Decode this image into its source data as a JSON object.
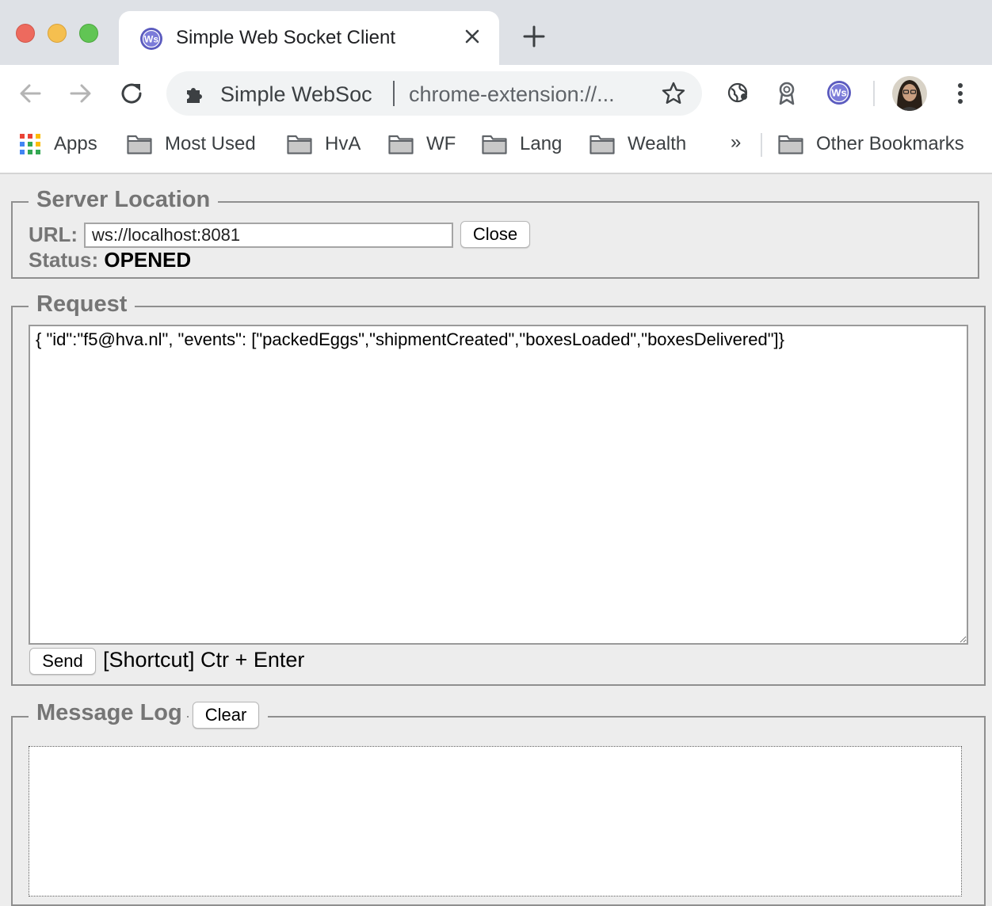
{
  "window": {
    "tab_title": "Simple Web Socket Client",
    "new_tab_symbol": "+",
    "close_symbol": "✕"
  },
  "toolbar": {
    "omnibox_site_name": "Simple WebSoc",
    "omnibox_url": "chrome-extension://..."
  },
  "bookmarks": {
    "items": [
      {
        "label": "Apps",
        "icon": "apps-grid-icon"
      },
      {
        "label": "Most Used",
        "icon": "folder-icon"
      },
      {
        "label": "HvA",
        "icon": "folder-icon"
      },
      {
        "label": "WF",
        "icon": "folder-icon"
      },
      {
        "label": "Lang",
        "icon": "folder-icon"
      },
      {
        "label": "Wealth",
        "icon": "folder-icon"
      }
    ],
    "overflow": "»",
    "other": "Other Bookmarks"
  },
  "server_location": {
    "legend": "Server Location",
    "url_label": "URL:",
    "url_value": "ws://localhost:8081",
    "close_button": "Close",
    "status_label": "Status:",
    "status_value": "OPENED"
  },
  "request": {
    "legend": "Request",
    "body": "{ \"id\":\"f5@hva.nl\", \"events\": [\"packedEggs\",\"shipmentCreated\",\"boxesLoaded\",\"boxesDelivered\"]}",
    "send_button": "Send",
    "shortcut_text": "[Shortcut] Ctr + Enter"
  },
  "message_log": {
    "legend": "Message Log",
    "clear_button": "Clear"
  },
  "colors": {
    "tabstrip": "#dee1e6",
    "page_background": "#ededed",
    "legend_text": "#757575"
  }
}
